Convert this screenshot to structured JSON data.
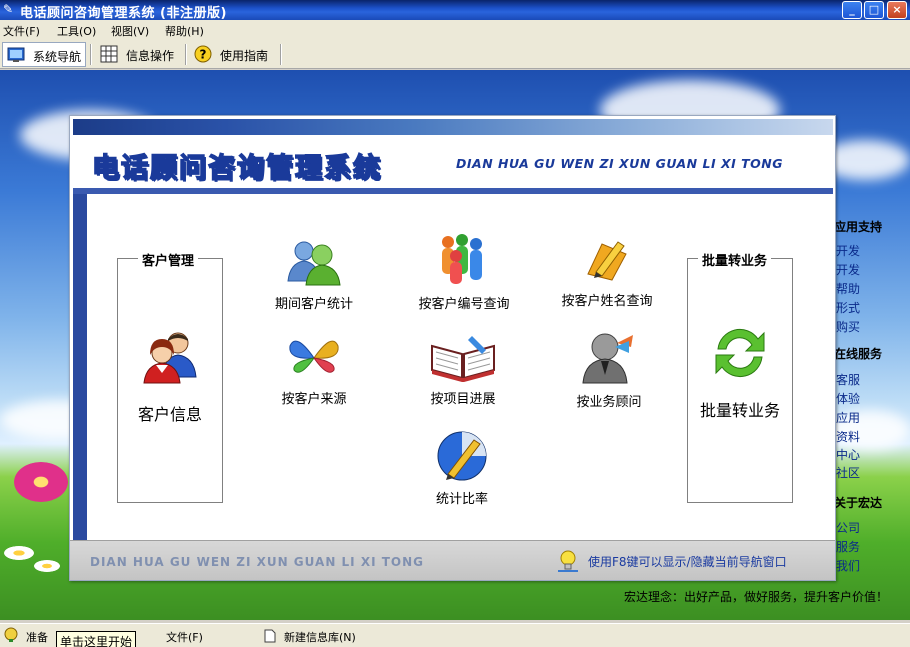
{
  "window": {
    "title": "电话顾问咨询管理系统 (非注册版)",
    "buttons": [
      "_",
      "□",
      "×"
    ]
  },
  "menu": {
    "items": [
      "文件(F)",
      "工具(O)",
      "视图(V)",
      "帮助(H)"
    ]
  },
  "toolbar": {
    "items": [
      {
        "label": "系统导航",
        "icon": "navigation-icon",
        "active": true
      },
      {
        "label": "信息操作",
        "icon": "grid-icon",
        "active": false
      },
      {
        "label": "使用指南",
        "icon": "help-icon",
        "active": false
      }
    ]
  },
  "side_panel": {
    "headings": [
      "应用支持",
      "在线服务",
      "关于宏达"
    ],
    "support_links": [
      "开发",
      "开发",
      "帮助",
      "形式",
      "购买"
    ],
    "service_links": [
      "客服",
      "体验",
      "应用",
      "资料",
      "中心",
      "社区"
    ],
    "about_links": [
      "公司",
      "服务",
      "我们"
    ],
    "motto": "宏达理念：出好产品，做好服务，提升客户价值！"
  },
  "panel": {
    "title": "电话顾问咨询管理系统",
    "subtitle": "DIAN HUA GU WEN ZI XUN GUAN LI XI TONG",
    "customer_group": {
      "title": "客户管理",
      "button_label": "客户信息"
    },
    "batch_group": {
      "title": "批量转业务",
      "button_label": "批量转业务"
    },
    "functions": [
      {
        "label": "期间客户统计",
        "icon": "users-stats-icon"
      },
      {
        "label": "按客户编号查询",
        "icon": "users-group-icon"
      },
      {
        "label": "按客户姓名查询",
        "icon": "pencil-folder-icon"
      },
      {
        "label": "按客户来源",
        "icon": "butterfly-icon"
      },
      {
        "label": "按项目进展",
        "icon": "open-book-icon"
      },
      {
        "label": "按业务顾问",
        "icon": "consultant-icon"
      },
      {
        "label": "统计比率",
        "icon": "pen-ratio-icon"
      }
    ],
    "bottom_subtitle": "DIAN HUA GU WEN ZI XUN GUAN LI XI TONG",
    "bottom_hint": "使用F8键可以显示/隐藏当前导航窗口"
  },
  "statusbar": {
    "ready": "准备",
    "tooltip": "单击这里开始",
    "file": "文件(F)",
    "new_db": "新建信息库(N)"
  },
  "colors": {
    "title_blue": "#1a3a9a",
    "accent": "#2a4aa0",
    "hint": "#1a3aa0"
  }
}
